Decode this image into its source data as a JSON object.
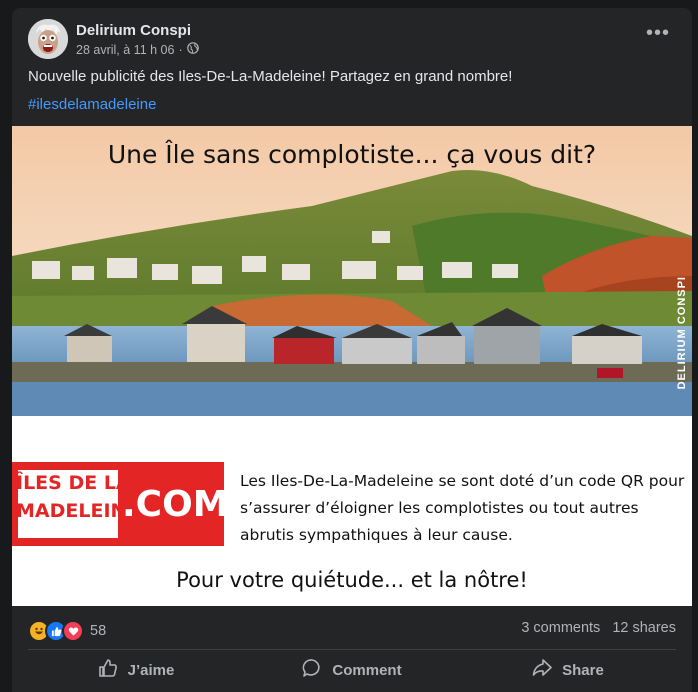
{
  "post": {
    "author": "Delirium Conspi",
    "timestamp": "28 avril, à 11 h 06",
    "separator": "·",
    "audience_icon": "globe-icon",
    "more_label": "•••",
    "text": "Nouvelle publicité des Iles-De-La-Madeleine! Partagez en grand nombre!",
    "hashtag": "#ilesdelamadeleine"
  },
  "media": {
    "title": "Une Île sans complotiste... ça vous dit?",
    "watermark": "DELIRIUM CONSPI",
    "logo_line1": "ÎLES DE LA",
    "logo_line2": "MADELEINE",
    "logo_com": ".COM",
    "description": "Les Iles-De-La-Madeleine se sont doté d’un code QR pour s’assurer d’éloigner les complotistes ou tout autres abrutis sympathiques à leur cause.",
    "tagline": "Pour votre quiétude... et la nôtre!"
  },
  "stats": {
    "reaction_icons": [
      "haha-icon",
      "like-icon",
      "love-icon"
    ],
    "reaction_count": "58",
    "comments": "3 comments",
    "shares": "12 shares"
  },
  "actions": {
    "like": "J’aime",
    "comment": "Comment",
    "share": "Share"
  },
  "colors": {
    "background": "#18191a",
    "card": "#242526",
    "link": "#4599ff",
    "brand_red": "#e32526"
  }
}
